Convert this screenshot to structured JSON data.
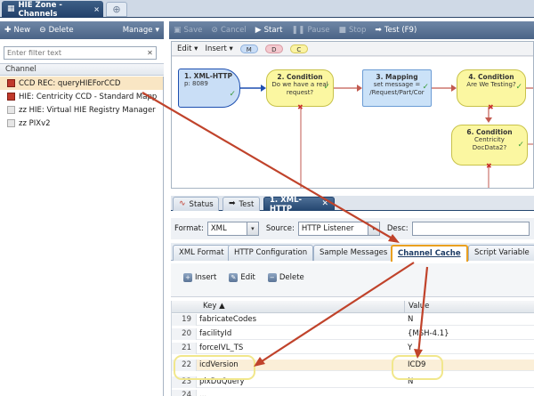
{
  "window": {
    "zone_tab": "HIE Zone - Channels"
  },
  "left_toolbar": {
    "new_label": "New",
    "delete_label": "Delete",
    "manage_label": "Manage"
  },
  "filter": {
    "placeholder": "Enter filter text"
  },
  "channels": {
    "header": "Channel",
    "items": [
      {
        "label": "CCD REC: queryHIEForCCD",
        "selected": true,
        "icon": "red-channel-icon"
      },
      {
        "label": "HIE: Centricity CCD - Standard Mapp",
        "selected": false,
        "icon": "red-channel-icon"
      },
      {
        "label": "zz HIE: Virtual HIE Registry Manager",
        "selected": false,
        "icon": "gray-channel-icon"
      },
      {
        "label": "zz PIXv2",
        "selected": false,
        "icon": "gray-channel-icon"
      }
    ]
  },
  "right_toolbar": {
    "save": "Save",
    "cancel": "Cancel",
    "start": "Start",
    "pause": "Pause",
    "stop": "Stop",
    "test": "Test (F9)"
  },
  "canvas_toolbar": {
    "edit": "Edit",
    "insert": "Insert",
    "chip_m": "M",
    "chip_d": "D",
    "chip_c": "C"
  },
  "flow": {
    "n1": {
      "title": "1. XML-HTTP",
      "sub": "p: 8089"
    },
    "n2": {
      "title": "2. Condition",
      "sub1": "Do we have a real",
      "sub2": "request?"
    },
    "n3": {
      "title": "3. Mapping",
      "sub1": "set message =",
      "sub2": "/Request/Part/Cor"
    },
    "n4": {
      "title": "4. Condition",
      "sub1": "Are We Testing?"
    },
    "n6": {
      "title": "6. Condition",
      "sub1": "Centricity",
      "sub2": "DocData2?"
    }
  },
  "lower_tabs": {
    "status": "Status",
    "test": "Test",
    "xml_http": "1. XML-HTTP"
  },
  "format_bar": {
    "format_label": "Format:",
    "format_value": "XML",
    "source_label": "Source:",
    "source_value": "HTTP Listener",
    "desc_label": "Desc:"
  },
  "sub_tabs": [
    "XML Format",
    "HTTP Configuration",
    "Sample Messages",
    "Channel Cache",
    "Script Variable"
  ],
  "cache_actions": {
    "insert": "Insert",
    "edit": "Edit",
    "delete": "Delete"
  },
  "grid": {
    "col_key": "Key ▲",
    "col_value": "Value",
    "rows": [
      {
        "num": "19",
        "key": "fabricateCodes",
        "value": "N"
      },
      {
        "num": "20",
        "key": "facilityId",
        "value": "{MSH-4.1}"
      },
      {
        "num": "21",
        "key": "forceIVL_TS",
        "value": "Y"
      },
      {
        "num": "22",
        "key": "icdVersion",
        "value": "ICD9"
      },
      {
        "num": "23",
        "key": "pixDuQuery",
        "value": "N"
      },
      {
        "num": "24",
        "key": "...",
        "value": ""
      }
    ]
  },
  "colors": {
    "accent": "#23456f",
    "highlight": "#fbefd8",
    "arrow": "#c0432b"
  }
}
